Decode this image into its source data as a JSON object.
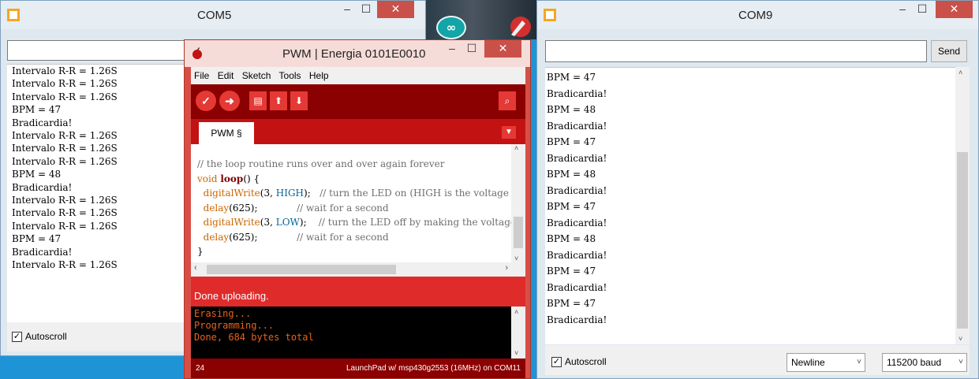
{
  "desktop": {
    "arduino_icon_label": "∞",
    "rocket_icon": "rocket-icon"
  },
  "com5": {
    "title": "COM5",
    "output_lines": [
      "Intervalo R-R = 1.26S",
      "Intervalo R-R = 1.26S",
      "Intervalo R-R = 1.26S",
      "BPM = 47",
      "Bradicardia!",
      "Intervalo R-R = 1.26S",
      "Intervalo R-R = 1.26S",
      "Intervalo R-R = 1.26S",
      "BPM = 48",
      "Bradicardia!",
      "Intervalo R-R = 1.26S",
      "Intervalo R-R = 1.26S",
      "Intervalo R-R = 1.26S",
      "BPM = 47",
      "Bradicardia!",
      "Intervalo R-R = 1.26S"
    ],
    "autoscroll_label": "Autoscroll",
    "autoscroll_checked": true
  },
  "com9": {
    "title": "COM9",
    "send_label": "Send",
    "output_lines": [
      "BPM = 47",
      "Bradicardia!",
      "BPM = 48",
      "Bradicardia!",
      "BPM = 47",
      "Bradicardia!",
      "BPM = 48",
      "Bradicardia!",
      "BPM = 47",
      "Bradicardia!",
      "BPM = 48",
      "Bradicardia!",
      "BPM = 47",
      "Bradicardia!",
      "BPM = 47",
      "Bradicardia!"
    ],
    "autoscroll_label": "Autoscroll",
    "autoscroll_checked": true,
    "line_ending": "Newline",
    "baud_rate": "115200 baud"
  },
  "energia": {
    "title": "PWM | Energia 0101E0010",
    "menu": [
      "File",
      "Edit",
      "Sketch",
      "Tools",
      "Help"
    ],
    "tab_label": "PWM §",
    "status_text": "Done uploading.",
    "console_lines": [
      "Erasing...",
      "Programming...",
      "Done, 684 bytes total"
    ],
    "line_number": "24",
    "board_info": "LaunchPad w/ msp430g2553 (16MHz) on COM11",
    "code": {
      "comment_line": "// the loop routine runs over and over again forever",
      "void_kw": "void",
      "loop_fn": "loop",
      "loop_rest": "() {",
      "dw1_fn": "digitalWrite",
      "dw1_args_a": "(3, ",
      "dw1_const": "HIGH",
      "dw1_args_b": ");   ",
      "dw1_comment": "// turn the LED on (HIGH is the voltage level)",
      "delay1_fn": "delay",
      "delay1_args": "(625);",
      "delay1_comment": "// wait for a second",
      "dw2_fn": "digitalWrite",
      "dw2_args_a": "(3, ",
      "dw2_const": "LOW",
      "dw2_args_b": ");    ",
      "dw2_comment": "// turn the LED off by making the voltage LOW",
      "delay2_fn": "delay",
      "delay2_args": "(625);",
      "delay2_comment": "// wait for a second",
      "close_brace": "}"
    }
  },
  "colors": {
    "energia_red": "#c31212",
    "energia_dark": "#8b0000",
    "desktop_blue": "#1e94d6"
  }
}
